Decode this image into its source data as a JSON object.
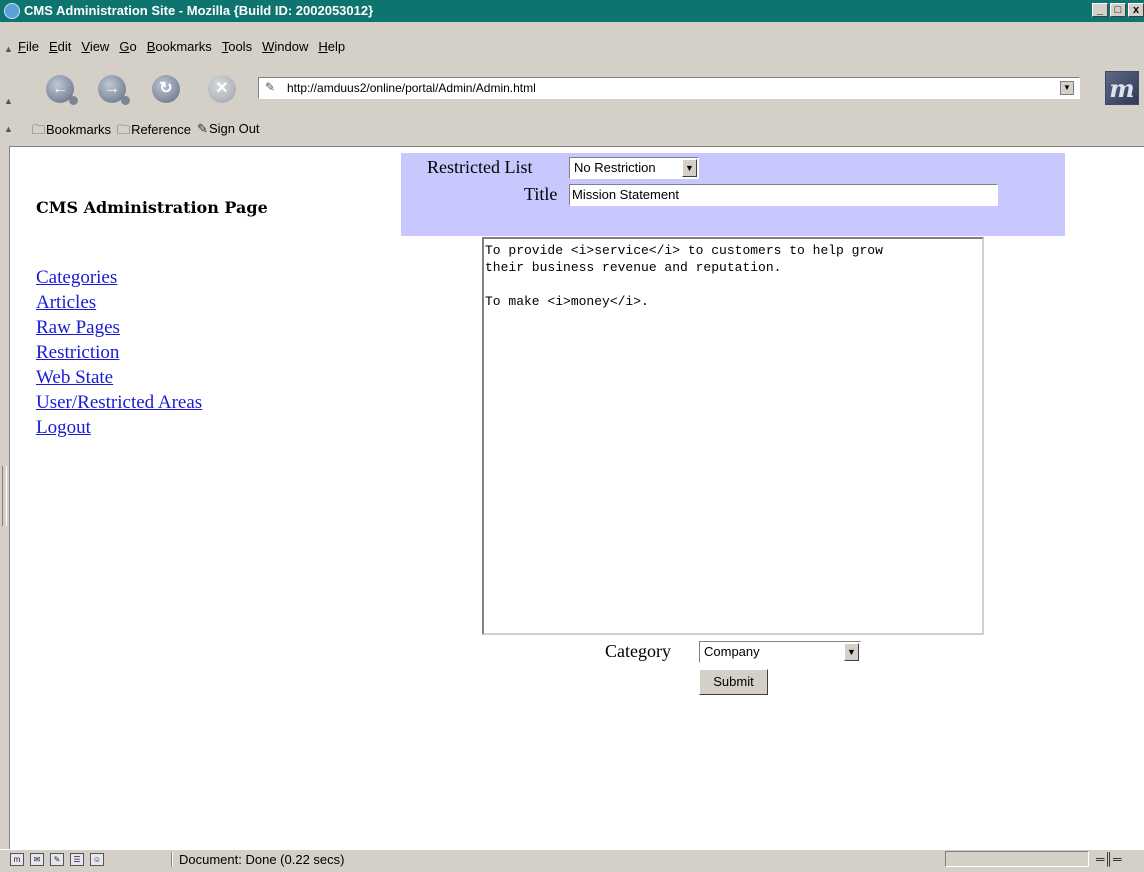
{
  "window": {
    "title": "CMS Administration Site - Mozilla {Build ID: 2002053012}",
    "controls": [
      "_",
      "□",
      "x"
    ]
  },
  "menubar": {
    "items": [
      "File",
      "Edit",
      "View",
      "Go",
      "Bookmarks",
      "Tools",
      "Window",
      "Help"
    ]
  },
  "toolbar": {
    "back_icon": "back-arrow-icon",
    "forward_icon": "forward-arrow-icon",
    "reload_icon": "reload-icon",
    "stop_icon": "stop-icon",
    "url": "http://amduus2/online/portal/Admin/Admin.html",
    "logo_label": "m"
  },
  "personal_toolbar": {
    "items": [
      "Bookmarks",
      "Reference",
      "Sign Out"
    ]
  },
  "sidebar": {
    "heading": "CMS Administration Page",
    "links": [
      "Categories",
      "Articles",
      "Raw Pages",
      "Restriction",
      "Web State",
      "User/Restricted Areas",
      "Logout"
    ]
  },
  "form": {
    "restricted_list_label": "Restricted List",
    "restricted_list_value": "No Restriction",
    "title_label": "Title",
    "title_value": "Mission Statement",
    "body_lines": [
      "To provide <i>service</i> to customers to help grow",
      "their business revenue and reputation.",
      "",
      "To make <i>money</i>."
    ],
    "category_label": "Category",
    "category_value": "Company",
    "submit_label": "Submit",
    "panel_color": "#c8c8ff"
  },
  "statusbar": {
    "text": "Document: Done (0.22 secs)"
  },
  "colors": {
    "titlebar": "#0e7470",
    "link": "#1a1ad6",
    "chrome": "#d4d0c8"
  }
}
